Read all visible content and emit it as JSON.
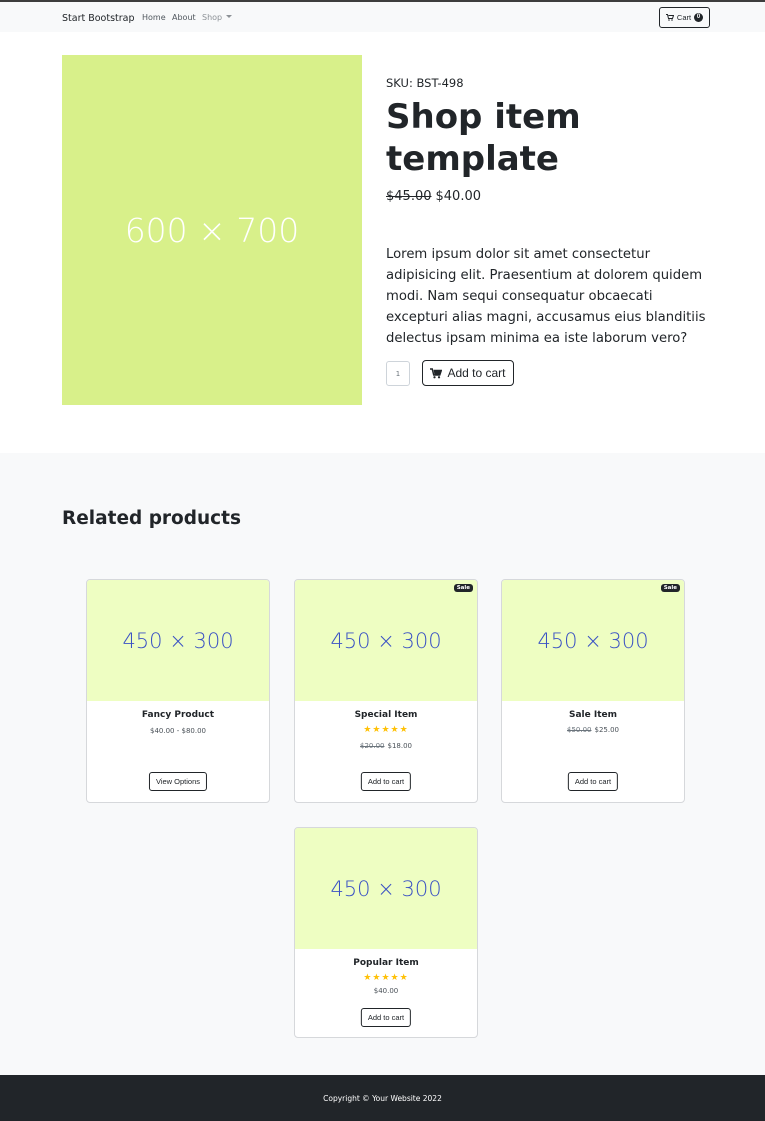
{
  "navbar": {
    "brand": "Start Bootstrap",
    "links": [
      "Home",
      "About",
      "Shop"
    ],
    "cart_label": "Cart",
    "cart_count": "0"
  },
  "product": {
    "image_label": "600 × 700",
    "sku": "SKU: BST-498",
    "title": "Shop item template",
    "old_price": "$45.00",
    "price": "$40.00",
    "description": "Lorem ipsum dolor sit amet consectetur adipisicing elit. Praesentium at dolorem quidem modi. Nam sequi consequatur obcaecati excepturi alias magni, accusamus eius blanditiis delectus ipsam minima ea iste laborum vero?",
    "quantity": "1",
    "add_to_cart": "Add to cart"
  },
  "related": {
    "heading": "Related products",
    "cards": [
      {
        "image_label": "450 × 300",
        "name": "Fancy Product",
        "price": "$40.00 - $80.00",
        "button": "View Options"
      },
      {
        "image_label": "450 × 300",
        "badge": "Sale",
        "name": "Special Item",
        "stars": "★★★★★",
        "old_price": "$20.00",
        "price": "$18.00",
        "button": "Add to cart"
      },
      {
        "image_label": "450 × 300",
        "badge": "Sale",
        "name": "Sale Item",
        "old_price": "$50.00",
        "price": "$25.00",
        "button": "Add to cart"
      },
      {
        "image_label": "450 × 300",
        "name": "Popular Item",
        "stars": "★★★★★",
        "price": "$40.00",
        "button": "Add to cart"
      }
    ]
  },
  "footer": {
    "copyright": "Copyright © Your Website 2022"
  },
  "colors": {
    "hero_placeholder": "#d8f08a",
    "card_placeholder": "#eefec2",
    "card_placeholder_text": "#3a52c4",
    "star": "#ffc107",
    "dark": "#212529"
  }
}
